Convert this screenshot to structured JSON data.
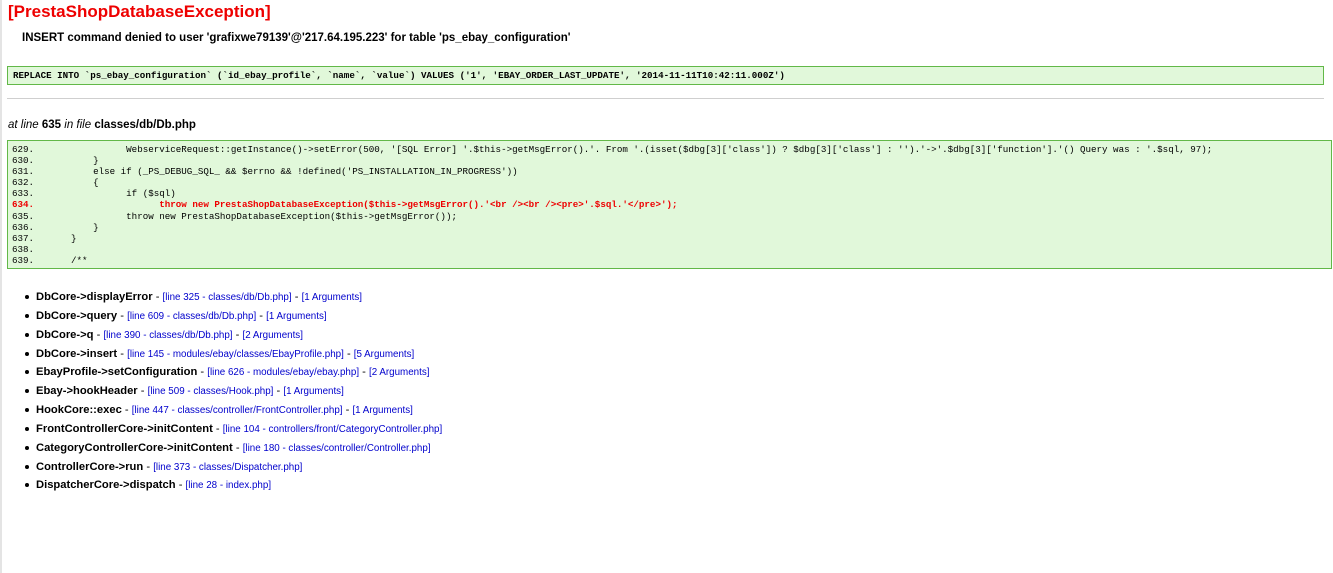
{
  "error": {
    "title": "[PrestaShopDatabaseException]",
    "message": "INSERT command denied to user 'grafixwe79139'@'217.64.195.223' for table 'ps_ebay_configuration'",
    "sql": "REPLACE INTO `ps_ebay_configuration` (`id_ebay_profile`, `name`, `value`) VALUES ('1', 'EBAY_ORDER_LAST_UPDATE', '2014-11-11T10:42:11.000Z')"
  },
  "location": {
    "at_line_text": "at line",
    "line": "635",
    "in_file_text": "in file",
    "file": "classes/db/Db.php"
  },
  "code": [
    {
      "num": "629.",
      "text": "            WebserviceRequest::getInstance()->setError(500, '[SQL Error] '.$this->getMsgError().'. From '.(isset($dbg[3]['class']) ? $dbg[3]['class'] : '').'->'.$dbg[3]['function'].'() Query was : '.$sql, 97);",
      "highlight": false
    },
    {
      "num": "630.",
      "text": "      }",
      "highlight": false
    },
    {
      "num": "631.",
      "text": "      else if (_PS_DEBUG_SQL_ && $errno && !defined('PS_INSTALLATION_IN_PROGRESS'))",
      "highlight": false
    },
    {
      "num": "632.",
      "text": "      {",
      "highlight": false
    },
    {
      "num": "633.",
      "text": "            if ($sql)",
      "highlight": false
    },
    {
      "num": "634.",
      "text": "                  throw new PrestaShopDatabaseException($this->getMsgError().'<br /><br /><pre>'.$sql.'</pre>');",
      "highlight": true
    },
    {
      "num": "635.",
      "text": "            throw new PrestaShopDatabaseException($this->getMsgError());",
      "highlight": false
    },
    {
      "num": "636.",
      "text": "      }",
      "highlight": false
    },
    {
      "num": "637.",
      "text": "  }",
      "highlight": false
    },
    {
      "num": "638.",
      "text": "",
      "highlight": false
    },
    {
      "num": "639.",
      "text": "  /**",
      "highlight": false
    }
  ],
  "trace": [
    {
      "fn": "DbCore->displayError",
      "location": "[line 325 - classes/db/Db.php]",
      "args": "[1 Arguments]"
    },
    {
      "fn": "DbCore->query",
      "location": "[line 609 - classes/db/Db.php]",
      "args": "[1 Arguments]"
    },
    {
      "fn": "DbCore->q",
      "location": "[line 390 - classes/db/Db.php]",
      "args": "[2 Arguments]"
    },
    {
      "fn": "DbCore->insert",
      "location": "[line 145 - modules/ebay/classes/EbayProfile.php]",
      "args": "[5 Arguments]"
    },
    {
      "fn": "EbayProfile->setConfiguration",
      "location": "[line 626 - modules/ebay/ebay.php]",
      "args": "[2 Arguments]"
    },
    {
      "fn": "Ebay->hookHeader",
      "location": "[line 509 - classes/Hook.php]",
      "args": "[1 Arguments]"
    },
    {
      "fn": "HookCore::exec",
      "location": "[line 447 - classes/controller/FrontController.php]",
      "args": "[1 Arguments]"
    },
    {
      "fn": "FrontControllerCore->initContent",
      "location": "[line 104 - controllers/front/CategoryController.php]",
      "args": ""
    },
    {
      "fn": "CategoryControllerCore->initContent",
      "location": "[line 180 - classes/controller/Controller.php]",
      "args": ""
    },
    {
      "fn": "ControllerCore->run",
      "location": "[line 373 - classes/Dispatcher.php]",
      "args": ""
    },
    {
      "fn": "DispatcherCore->dispatch",
      "location": "[line 28 - index.php]",
      "args": ""
    }
  ],
  "separator": "-",
  "colors": {
    "title": "#ee0000",
    "highlight_line": "#ee0000",
    "box_background": "#e1f8da",
    "box_border": "#62b848",
    "link": "#0000cc"
  }
}
